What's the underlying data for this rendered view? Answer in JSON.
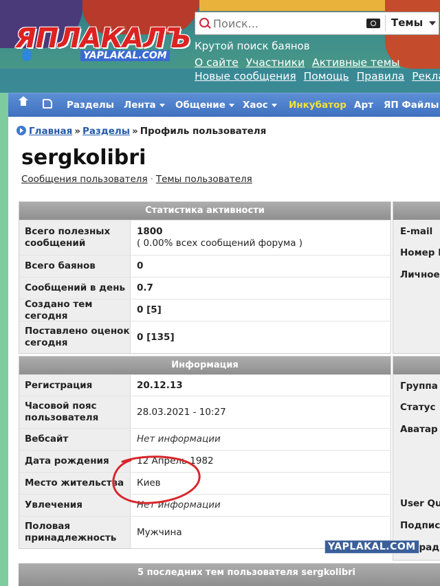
{
  "header": {
    "logo_text": "ЯПЛАКАЛЪ",
    "logo_sub": "YAPLAKAL.COM",
    "search": {
      "placeholder": "Поиск...",
      "dropdown": "Темы"
    },
    "slogan": "Крутой поиск баянов",
    "links_row1": [
      "О сайте",
      "Участники",
      "Активные темы"
    ],
    "links_row2": [
      "Новые сообщения",
      "Помощь",
      "Правила",
      "Реклам"
    ]
  },
  "nav": {
    "items": [
      "Разделы",
      "Лента",
      "Общение",
      "Хаос",
      "Инкубатор",
      "Арт",
      "ЯП Файлы"
    ]
  },
  "breadcrumb": {
    "home": "Главная",
    "sections": "Разделы",
    "current": "Профиль пользователя",
    "sep": "»"
  },
  "profile": {
    "username": "sergkolibri",
    "link_posts": "Сообщения пользователя",
    "link_topics": "Темы пользователя",
    "link_sep": "·"
  },
  "stats": {
    "title": "Статистика активности",
    "rows": [
      {
        "label": "Всего полезных сообщений",
        "value": "1800",
        "sub": "( 0.00% всех сообщений форума )"
      },
      {
        "label": "Всего баянов",
        "value": "0"
      },
      {
        "label": "Сообщений в день",
        "value": "0.7"
      },
      {
        "label": "Создано тем сегодня",
        "value": "0 [5]"
      },
      {
        "label": "Поставлено оценок сегодня",
        "value": "0 [135]"
      }
    ]
  },
  "info": {
    "title": "Информация",
    "rows": [
      {
        "label": "Регистрация",
        "value": "20.12.13"
      },
      {
        "label": "Часовой пояс пользователя",
        "value": "28.03.2021 - 10:27"
      },
      {
        "label": "Вебсайт",
        "value": "Нет информации"
      },
      {
        "label": "Дата рождения",
        "value": "12 Апрель 1982"
      },
      {
        "label": "Место жительства",
        "value": "Киев"
      },
      {
        "label": "Увлечения",
        "value": "Нет информации"
      },
      {
        "label": "Половая принадлежность",
        "value": "Мужчина"
      }
    ]
  },
  "side_contact": {
    "labels": [
      "E-mail",
      "Номер IC",
      "Личное п"
    ]
  },
  "side_info": {
    "labels": [
      "Группа",
      "Статус",
      "Аватар",
      "User Qua",
      "Подпись",
      "Награды"
    ]
  },
  "bottom": {
    "title": "5 последних тем пользователя sergkolibri"
  },
  "watermark": "YAPLAKAL.COM",
  "colors": {
    "nav": "#4f82cf",
    "incubator": "#f3e23a",
    "link": "#245aa8",
    "panel_head": "#9e9e9e",
    "annotation": "#d8262b"
  }
}
